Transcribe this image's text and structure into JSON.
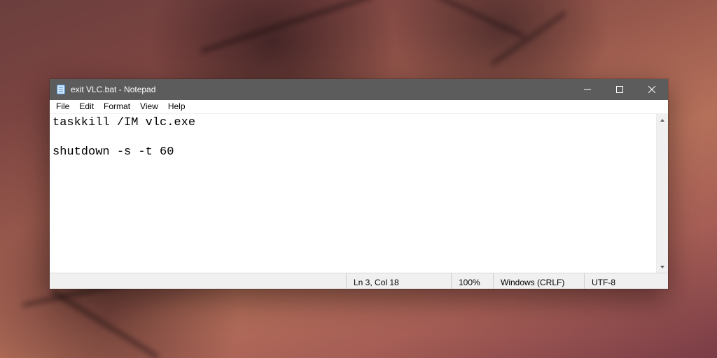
{
  "window": {
    "title": "exit VLC.bat - Notepad"
  },
  "menu": {
    "file": "File",
    "edit": "Edit",
    "format": "Format",
    "view": "View",
    "help": "Help"
  },
  "editor": {
    "content": "taskkill /IM vlc.exe\n\nshutdown -s -t 60"
  },
  "status": {
    "position": "Ln 3, Col 18",
    "zoom": "100%",
    "eol": "Windows (CRLF)",
    "encoding": "UTF-8"
  }
}
